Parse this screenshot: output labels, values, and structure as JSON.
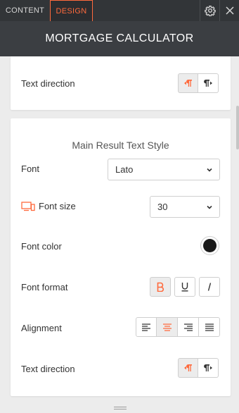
{
  "tabs": {
    "content_label": "CONTENT",
    "design_label": "DESIGN",
    "active": "design"
  },
  "header": {
    "title": "MORTGAGE CALCULATOR"
  },
  "top_panel": {
    "text_direction_label": "Text direction",
    "text_direction_value": "rtl"
  },
  "main_panel": {
    "section_title": "Main Result Text Style",
    "font_label": "Font",
    "font_value": "Lato",
    "font_size_label": "Font size",
    "font_size_value": "30",
    "font_color_label": "Font color",
    "font_color_value": "#1a1a1a",
    "font_format_label": "Font format",
    "font_format": {
      "bold": true,
      "underline": false,
      "italic": false
    },
    "alignment_label": "Alignment",
    "alignment_value": "center",
    "text_direction_label": "Text direction",
    "text_direction_value": "rtl"
  },
  "colors": {
    "accent": "#ff6a3d",
    "header_bg": "#3b3e42",
    "tabbar_bg": "#323538",
    "page_bg": "#ececec"
  },
  "icons": {
    "settings": "gear-icon",
    "close": "close-icon",
    "device": "desktop-mobile-icon",
    "chevron": "chevron-down-icon"
  }
}
